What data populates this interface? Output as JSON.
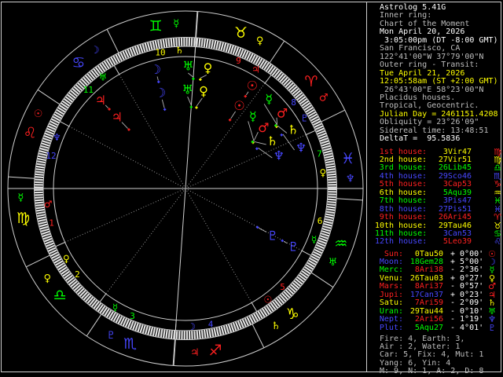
{
  "app_title": "Astrolog 5.41G",
  "colors": {
    "red": "#ff2020",
    "yellow": "#ffff00",
    "green": "#00ff00",
    "blue": "#4747ff",
    "white": "#ffffff",
    "gray": "#bdbdbd",
    "line": "#cfcfcf",
    "dim": "#949494",
    "tick": "#e2e2e2",
    "background": "#000000"
  },
  "panel": {
    "header_lines": [
      {
        "text": "Astrolog 5.41G",
        "color": "white"
      },
      {
        "text": "Inner ring:",
        "color": "gray"
      },
      {
        "text": "Chart of the Moment",
        "color": "gray"
      },
      {
        "text": "Mon April 20, 2026",
        "color": "white"
      },
      {
        "text": " 3:05:00pm (DT -8:00 GMT)",
        "color": "white"
      },
      {
        "text": "San Francisco, CA",
        "color": "gray"
      },
      {
        "text": "122°41'00\"W 37°79'00\"N",
        "color": "gray"
      },
      {
        "text": "Outer ring - Transit:",
        "color": "gray"
      },
      {
        "text": "Tue April 21, 2026",
        "color": "yellow"
      },
      {
        "text": "12:05:58am (ST +2:00 GMT)",
        "color": "yellow"
      },
      {
        "text": " 26°43'00\"E 58°23'00\"N",
        "color": "gray"
      },
      {
        "text": "Placidus houses.",
        "color": "gray"
      },
      {
        "text": "Tropical, Geocentric.",
        "color": "gray"
      },
      {
        "text": "Julian Day = 2461151.4208",
        "color": "yellow"
      },
      {
        "text": "Obliquity = 23°26'09\"",
        "color": "gray"
      },
      {
        "text": "Sidereal time: 13:48:51",
        "color": "gray"
      },
      {
        "text": "DeltaT =  95.5836",
        "color": "white"
      }
    ],
    "houses": [
      {
        "label": "1st house:",
        "lc": "red",
        "value": "3Vir47",
        "vc": "yellow",
        "glyph": "♍",
        "gc": "red"
      },
      {
        "label": "2nd house:",
        "lc": "yellow",
        "value": "27Vir51",
        "vc": "yellow",
        "glyph": "♍",
        "gc": "yellow"
      },
      {
        "label": "3rd house:",
        "lc": "green",
        "value": "26Lib45",
        "vc": "green",
        "glyph": "♎",
        "gc": "green"
      },
      {
        "label": "4th house:",
        "lc": "blue",
        "value": "29Sco46",
        "vc": "blue",
        "glyph": "♏",
        "gc": "blue"
      },
      {
        "label": "5th house:",
        "lc": "red",
        "value": "3Cap53",
        "vc": "red",
        "glyph": "♑",
        "gc": "red"
      },
      {
        "label": "6th house:",
        "lc": "yellow",
        "value": "5Aqu39",
        "vc": "green",
        "glyph": "♒",
        "gc": "yellow"
      },
      {
        "label": "7th house:",
        "lc": "green",
        "value": "3Pis47",
        "vc": "blue",
        "glyph": "♓",
        "gc": "green"
      },
      {
        "label": "8th house:",
        "lc": "blue",
        "value": "27Pis51",
        "vc": "blue",
        "glyph": "♓",
        "gc": "blue"
      },
      {
        "label": "9th house:",
        "lc": "red",
        "value": "26Ari45",
        "vc": "red",
        "glyph": "♈",
        "gc": "red"
      },
      {
        "label": "10th house:",
        "lc": "yellow",
        "value": "29Tau46",
        "vc": "yellow",
        "glyph": "♉",
        "gc": "yellow"
      },
      {
        "label": "11th house:",
        "lc": "green",
        "value": "3Can53",
        "vc": "blue",
        "glyph": "♋",
        "gc": "green"
      },
      {
        "label": "12th house:",
        "lc": "blue",
        "value": "5Leo39",
        "vc": "red",
        "glyph": "♌",
        "gc": "blue"
      }
    ],
    "planets": [
      {
        "label": "Sun:",
        "lc": "red",
        "value": "0Tau50",
        "vc": "yellow",
        "delta": "+ 0°00'",
        "glyph": "☉",
        "gc": "red"
      },
      {
        "label": "Moon:",
        "lc": "blue",
        "value": "18Gem28",
        "vc": "green",
        "delta": "+ 5°00'",
        "glyph": "☽",
        "gc": "blue"
      },
      {
        "label": "Merc:",
        "lc": "green",
        "value": "8Ari38",
        "vc": "red",
        "delta": "- 2°36'",
        "glyph": "☿",
        "gc": "green"
      },
      {
        "label": "Venu:",
        "lc": "yellow",
        "value": "26Tau03",
        "vc": "yellow",
        "delta": "+ 0°27'",
        "glyph": "♀",
        "gc": "yellow"
      },
      {
        "label": "Mars:",
        "lc": "red",
        "value": "8Ari37",
        "vc": "red",
        "delta": "- 0°57'",
        "glyph": "♂",
        "gc": "red"
      },
      {
        "label": "Jupi:",
        "lc": "red",
        "value": "17Can37",
        "vc": "blue",
        "delta": "+ 0°23'",
        "glyph": "♃",
        "gc": "red"
      },
      {
        "label": "Satu:",
        "lc": "yellow",
        "value": "7Ari59",
        "vc": "red",
        "delta": "- 2°09'",
        "glyph": "♄",
        "gc": "yellow"
      },
      {
        "label": "Uran:",
        "lc": "green",
        "value": "29Tau44",
        "vc": "yellow",
        "delta": "- 0°10'",
        "glyph": "♅",
        "gc": "green"
      },
      {
        "label": "Nept:",
        "lc": "blue",
        "value": "2Ari56",
        "vc": "red",
        "delta": "- 1°19'",
        "glyph": "♆",
        "gc": "blue"
      },
      {
        "label": "Plut:",
        "lc": "blue",
        "value": "5Aqu27",
        "vc": "green",
        "delta": "- 4°01'",
        "glyph": "♇",
        "gc": "blue"
      }
    ],
    "totals_lines": [
      "Fire: 4, Earth: 3,",
      "Air : 2, Water: 1",
      "Car: 5, Fix: 4, Mut: 1",
      "Yang: 6, Yin: 4",
      "M: 9, N: 1, A: 2, D: 8"
    ]
  },
  "wheel": {
    "asc_lon": 153.783,
    "signs": [
      {
        "name": "aries",
        "glyph": "♈",
        "color": "red",
        "ruler": {
          "name": "mars",
          "glyph": "♂",
          "color": "red"
        }
      },
      {
        "name": "taurus",
        "glyph": "♉",
        "color": "yellow",
        "ruler": {
          "name": "venus",
          "glyph": "♀",
          "color": "yellow"
        }
      },
      {
        "name": "gemini",
        "glyph": "♊",
        "color": "green",
        "ruler": {
          "name": "mercury",
          "glyph": "☿",
          "color": "green"
        }
      },
      {
        "name": "cancer",
        "glyph": "♋",
        "color": "blue",
        "ruler": {
          "name": "moon",
          "glyph": "☽",
          "color": "blue"
        }
      },
      {
        "name": "leo",
        "glyph": "♌",
        "color": "red",
        "ruler": {
          "name": "sun",
          "glyph": "☉",
          "color": "red"
        }
      },
      {
        "name": "virgo",
        "glyph": "♍",
        "color": "yellow",
        "ruler": {
          "name": "mercury",
          "glyph": "☿",
          "color": "green"
        }
      },
      {
        "name": "libra",
        "glyph": "♎",
        "color": "green",
        "ruler": {
          "name": "venus",
          "glyph": "♀",
          "color": "yellow"
        }
      },
      {
        "name": "scorpio",
        "glyph": "♏",
        "color": "blue",
        "ruler": {
          "name": "pluto",
          "glyph": "♇",
          "color": "blue"
        }
      },
      {
        "name": "sagittarius",
        "glyph": "♐",
        "color": "red",
        "ruler": {
          "name": "jupiter",
          "glyph": "♃",
          "color": "red"
        }
      },
      {
        "name": "capricorn",
        "glyph": "♑",
        "color": "yellow",
        "ruler": {
          "name": "saturn",
          "glyph": "♄",
          "color": "yellow"
        }
      },
      {
        "name": "aquarius",
        "glyph": "♒",
        "color": "green",
        "ruler": {
          "name": "uranus",
          "glyph": "♅",
          "color": "green"
        }
      },
      {
        "name": "pisces",
        "glyph": "♓",
        "color": "blue",
        "ruler": {
          "name": "neptune",
          "glyph": "♆",
          "color": "blue"
        }
      }
    ],
    "house_cusps": [
      153.783,
      177.85,
      206.75,
      239.767,
      273.883,
      305.65,
      333.783,
      357.85,
      26.75,
      59.767,
      93.883,
      125.65
    ],
    "house_number_colors": [
      "red",
      "yellow",
      "green",
      "blue",
      "red",
      "yellow",
      "green",
      "blue",
      "red",
      "yellow",
      "green",
      "blue"
    ],
    "inner_planets": [
      {
        "name": "sun",
        "glyph": "☉",
        "color": "red",
        "lon": 30.833
      },
      {
        "name": "moon",
        "glyph": "☽",
        "color": "blue",
        "lon": 78.467
      },
      {
        "name": "mercury",
        "glyph": "☿",
        "color": "green",
        "lon": 8.633
      },
      {
        "name": "venus",
        "glyph": "♀",
        "color": "yellow",
        "lon": 56.05
      },
      {
        "name": "mars",
        "glyph": "♂",
        "color": "red",
        "lon": 8.617
      },
      {
        "name": "jupiter",
        "glyph": "♃",
        "color": "red",
        "lon": 107.617
      },
      {
        "name": "saturn",
        "glyph": "♄",
        "color": "yellow",
        "lon": 7.983
      },
      {
        "name": "uranus",
        "glyph": "♅",
        "color": "green",
        "lon": 59.733
      },
      {
        "name": "neptune",
        "glyph": "♆",
        "color": "blue",
        "lon": 2.933
      },
      {
        "name": "pluto",
        "glyph": "♇",
        "color": "blue",
        "lon": 305.45
      }
    ],
    "outer_planets": [
      {
        "name": "sun",
        "glyph": "☉",
        "color": "red",
        "lon": 30.79
      },
      {
        "name": "moon",
        "glyph": "☽",
        "color": "blue",
        "lon": 77.92
      },
      {
        "name": "mercury",
        "glyph": "☿",
        "color": "green",
        "lon": 8.74
      },
      {
        "name": "venus",
        "glyph": "♀",
        "color": "yellow",
        "lon": 56.02
      },
      {
        "name": "mars",
        "glyph": "♂",
        "color": "red",
        "lon": 8.58
      },
      {
        "name": "jupiter",
        "glyph": "♃",
        "color": "red",
        "lon": 107.61
      },
      {
        "name": "saturn",
        "glyph": "♄",
        "color": "yellow",
        "lon": 7.98
      },
      {
        "name": "uranus",
        "glyph": "♅",
        "color": "green",
        "lon": 59.72
      },
      {
        "name": "neptune",
        "glyph": "♆",
        "color": "blue",
        "lon": 2.93
      },
      {
        "name": "pluto",
        "glyph": "♇",
        "color": "blue",
        "lon": 305.455
      }
    ]
  }
}
